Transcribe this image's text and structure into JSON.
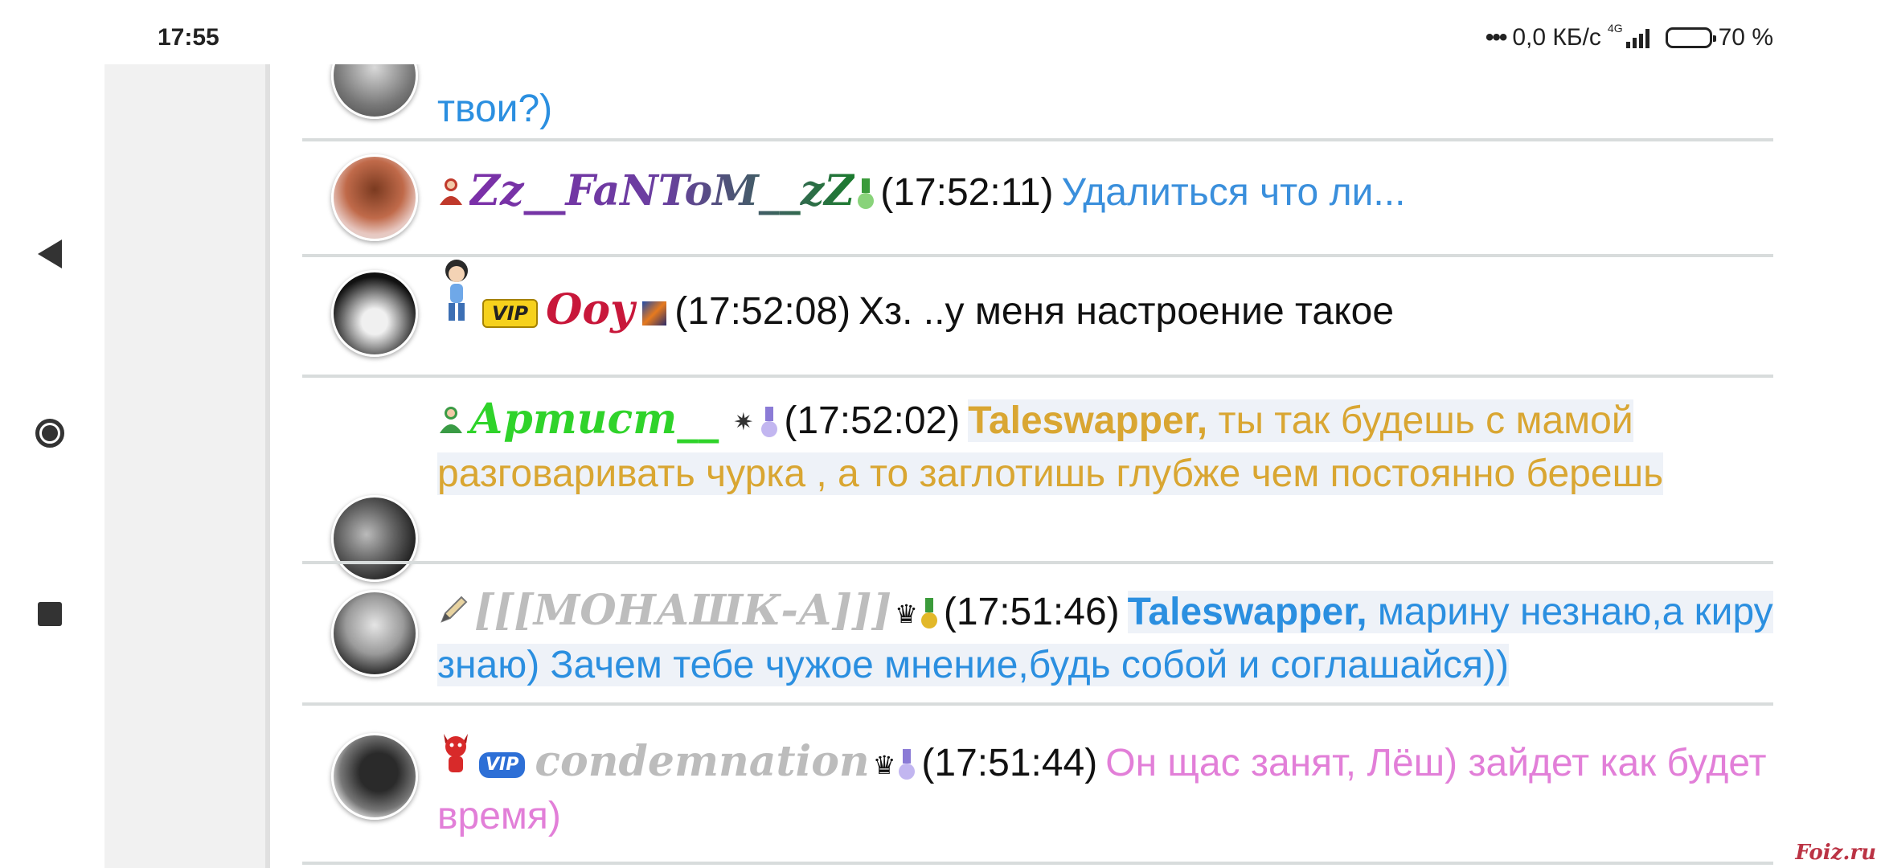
{
  "status_bar": {
    "time": "17:55",
    "net_speed": "0,0 КБ/с",
    "network": "4G",
    "battery": "70 %"
  },
  "navigation": {
    "back": "back-icon",
    "home": "home-icon",
    "recent": "recent-apps-icon"
  },
  "messages": [
    {
      "text_partial": "твои?)",
      "text_color": "#2b8fe0"
    },
    {
      "nick": "Zz__FaNToM__zZ",
      "time": "(17:52:11)",
      "text": "Удалиться что ли...",
      "text_color": "#3a8fdc"
    },
    {
      "nick": "Ooy",
      "badge": "VIP",
      "time": "(17:52:08)",
      "text": "Хз. ..у меня настроение такое",
      "text_color": "#111111"
    },
    {
      "nick": "Артист__",
      "time": "(17:52:02)",
      "addressee": "Taleswapper,",
      "text": "ты так будешь с мамой разговаривать чурка , а то заглотишь глубже чем постоянно берешь",
      "text_color": "#d9a632"
    },
    {
      "nick": "[[[МОНАШК-А]]]",
      "time": "(17:51:46)",
      "addressee": "Taleswapper,",
      "text": "марину незнаю,а киру знаю) Зачем тебе чужое мнение,будь собой и соглашайся))",
      "text_color": "#2b8fe0"
    },
    {
      "nick": "condemnation",
      "badge": "VIP",
      "time": "(17:51:44)",
      "text": "Он щас занят, Лёш) зайдет как будет время)",
      "text_color": "#e27fd8"
    }
  ],
  "watermark": "Foiz.ru"
}
